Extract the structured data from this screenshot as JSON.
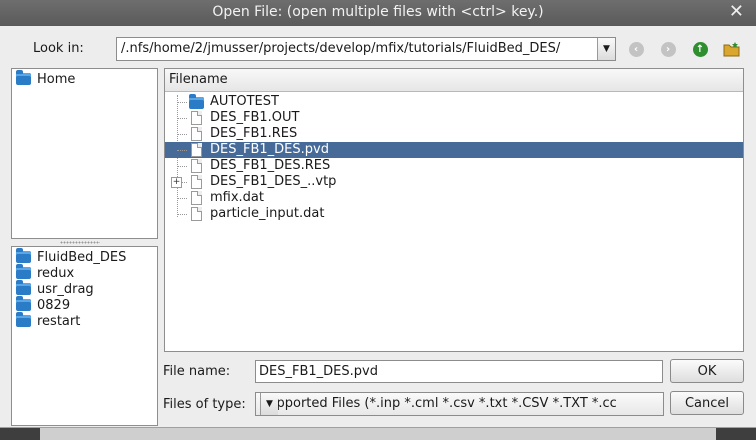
{
  "window": {
    "title": "Open File:  (open multiple files with <ctrl> key.)",
    "close_glyph": "✕"
  },
  "look_in": {
    "label": "Look in:",
    "path": "/.nfs/home/2/jmusser/projects/develop/mfix/tutorials/FluidBed_DES/"
  },
  "nav_icons": [
    "back-icon",
    "forward-icon",
    "up-icon",
    "new-folder-icon"
  ],
  "places": [
    {
      "label": "Home",
      "icon": "folder-icon"
    }
  ],
  "recent": [
    {
      "label": "FluidBed_DES"
    },
    {
      "label": "redux"
    },
    {
      "label": "usr_drag"
    },
    {
      "label": "0829"
    },
    {
      "label": "restart"
    }
  ],
  "files": {
    "column_header": "Filename",
    "items": [
      {
        "name": "AUTOTEST",
        "type": "folder",
        "selected": false
      },
      {
        "name": "DES_FB1.OUT",
        "type": "file",
        "selected": false
      },
      {
        "name": "DES_FB1.RES",
        "type": "file",
        "selected": false
      },
      {
        "name": "DES_FB1_DES.pvd",
        "type": "file",
        "selected": true
      },
      {
        "name": "DES_FB1_DES.RES",
        "type": "file",
        "selected": false
      },
      {
        "name": "DES_FB1_DES_..vtp",
        "type": "file",
        "selected": false,
        "expandable": true
      },
      {
        "name": "mfix.dat",
        "type": "file",
        "selected": false
      },
      {
        "name": "particle_input.dat",
        "type": "file",
        "selected": false
      }
    ]
  },
  "filename": {
    "label": "File name:",
    "value": "DES_FB1_DES.pvd"
  },
  "filetype": {
    "label": "Files of type:",
    "value": "Supported Files (*.inp  *.cml  *.csv *.txt *.CSV *.TXT  *.cc"
  },
  "buttons": {
    "ok": "OK",
    "cancel": "Cancel"
  },
  "colors": {
    "selection": "#476b99",
    "titlebar": "#5f5f5f",
    "folder": "#2b7cc6"
  }
}
